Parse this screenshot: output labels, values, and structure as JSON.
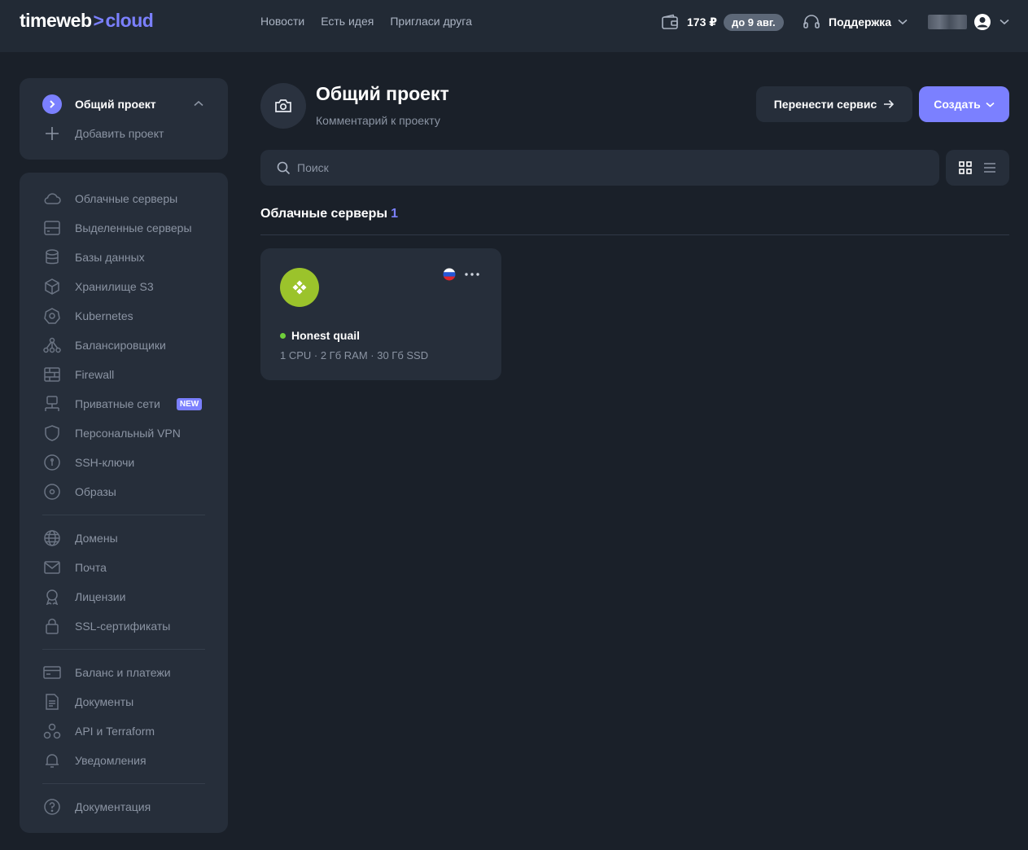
{
  "header": {
    "logo_part1": "timeweb",
    "logo_arrow": ">",
    "logo_part2": "cloud",
    "nav": [
      "Новости",
      "Есть идея",
      "Пригласи друга"
    ],
    "balance": "173 ₽",
    "balance_until": "до 9 авг.",
    "support": "Поддержка"
  },
  "project_switcher": {
    "current": "Общий проект",
    "add_label": "Добавить проект"
  },
  "sidebar": {
    "items": [
      {
        "label": "Облачные серверы",
        "icon": "cloud-icon"
      },
      {
        "label": "Выделенные серверы",
        "icon": "server-rack-icon"
      },
      {
        "label": "Базы данных",
        "icon": "database-icon"
      },
      {
        "label": "Хранилище S3",
        "icon": "cube-icon"
      },
      {
        "label": "Kubernetes",
        "icon": "kubernetes-icon"
      },
      {
        "label": "Балансировщики",
        "icon": "balancer-icon"
      },
      {
        "label": "Firewall",
        "icon": "firewall-icon"
      },
      {
        "label": "Приватные сети",
        "icon": "network-icon",
        "badge": "NEW"
      },
      {
        "label": "Персональный VPN",
        "icon": "shield-icon"
      },
      {
        "label": "SSH-ключи",
        "icon": "key-icon"
      },
      {
        "label": "Образы",
        "icon": "disc-icon"
      },
      {
        "label": "Домены",
        "icon": "globe-icon"
      },
      {
        "label": "Почта",
        "icon": "mail-icon"
      },
      {
        "label": "Лицензии",
        "icon": "license-icon"
      },
      {
        "label": "SSL-сертификаты",
        "icon": "lock-icon"
      },
      {
        "label": "Баланс и платежи",
        "icon": "card-icon"
      },
      {
        "label": "Документы",
        "icon": "document-icon"
      },
      {
        "label": "API и Terraform",
        "icon": "api-icon"
      },
      {
        "label": "Уведомления",
        "icon": "bell-icon"
      },
      {
        "label": "Документация",
        "icon": "help-icon"
      }
    ]
  },
  "main": {
    "title": "Общий проект",
    "subtitle": "Комментарий к проекту",
    "transfer_button": "Перенести сервис",
    "create_button": "Создать",
    "search_placeholder": "Поиск",
    "section_title": "Облачные серверы",
    "section_count": "1",
    "servers": [
      {
        "name": "Honest quail",
        "specs": "1 CPU · 2 Гб RAM · 30 Гб SSD",
        "status_color": "#6fcf3a",
        "os_color": "#9bc32b",
        "region": "ru-flag"
      }
    ]
  },
  "colors": {
    "accent": "#7b80ff",
    "background": "#1a2029",
    "panel": "#262e3a",
    "muted_text": "#8b94a3"
  }
}
